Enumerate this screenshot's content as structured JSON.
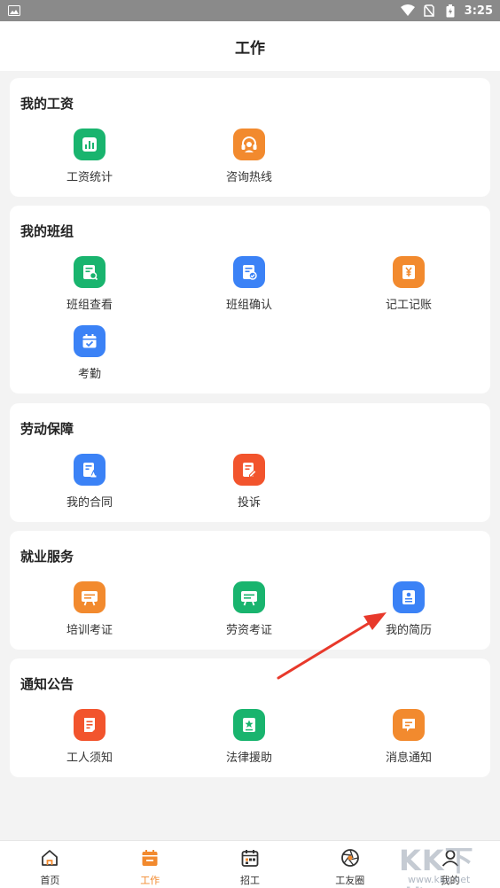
{
  "status": {
    "time": "3:25"
  },
  "header": {
    "title": "工作"
  },
  "sections": [
    {
      "title": "我的工资",
      "items": [
        {
          "label": "工资统计",
          "icon": "bar-chart-icon",
          "color": "#19b46e"
        },
        {
          "label": "咨询热线",
          "icon": "headset-icon",
          "color": "#f28a2e"
        }
      ]
    },
    {
      "title": "我的班组",
      "items": [
        {
          "label": "班组查看",
          "icon": "doc-search-icon",
          "color": "#19b46e"
        },
        {
          "label": "班组确认",
          "icon": "doc-check-icon",
          "color": "#3b82f6"
        },
        {
          "label": "记工记账",
          "icon": "yen-book-icon",
          "color": "#f28a2e"
        },
        {
          "label": "考勤",
          "icon": "calendar-check-icon",
          "color": "#3b82f6"
        }
      ]
    },
    {
      "title": "劳动保障",
      "items": [
        {
          "label": "我的合同",
          "icon": "contract-icon",
          "color": "#3b82f6"
        },
        {
          "label": "投诉",
          "icon": "complaint-icon",
          "color": "#f2542d"
        }
      ]
    },
    {
      "title": "就业服务",
      "items": [
        {
          "label": "培训考证",
          "icon": "training-board-icon",
          "color": "#f28a2e"
        },
        {
          "label": "劳资考证",
          "icon": "labor-board-icon",
          "color": "#19b46e"
        },
        {
          "label": "我的简历",
          "icon": "resume-icon",
          "color": "#3b82f6"
        }
      ]
    },
    {
      "title": "通知公告",
      "items": [
        {
          "label": "工人须知",
          "icon": "notice-doc-icon",
          "color": "#f2542d"
        },
        {
          "label": "法律援助",
          "icon": "legal-star-icon",
          "color": "#19b46e"
        },
        {
          "label": "消息通知",
          "icon": "message-icon",
          "color": "#f28a2e"
        }
      ]
    }
  ],
  "nav": [
    {
      "label": "首页",
      "icon": "home-icon"
    },
    {
      "label": "工作",
      "icon": "work-calendar-icon",
      "active": true
    },
    {
      "label": "招工",
      "icon": "recruit-calendar-icon"
    },
    {
      "label": "工友圈",
      "icon": "aperture-icon"
    },
    {
      "label": "我的",
      "icon": "profile-icon"
    }
  ],
  "watermark": {
    "text": "KK下载",
    "url": "www.kkx.net"
  },
  "colors": {
    "accent": "#f28a2e",
    "annotation_arrow": "#e8392b"
  }
}
